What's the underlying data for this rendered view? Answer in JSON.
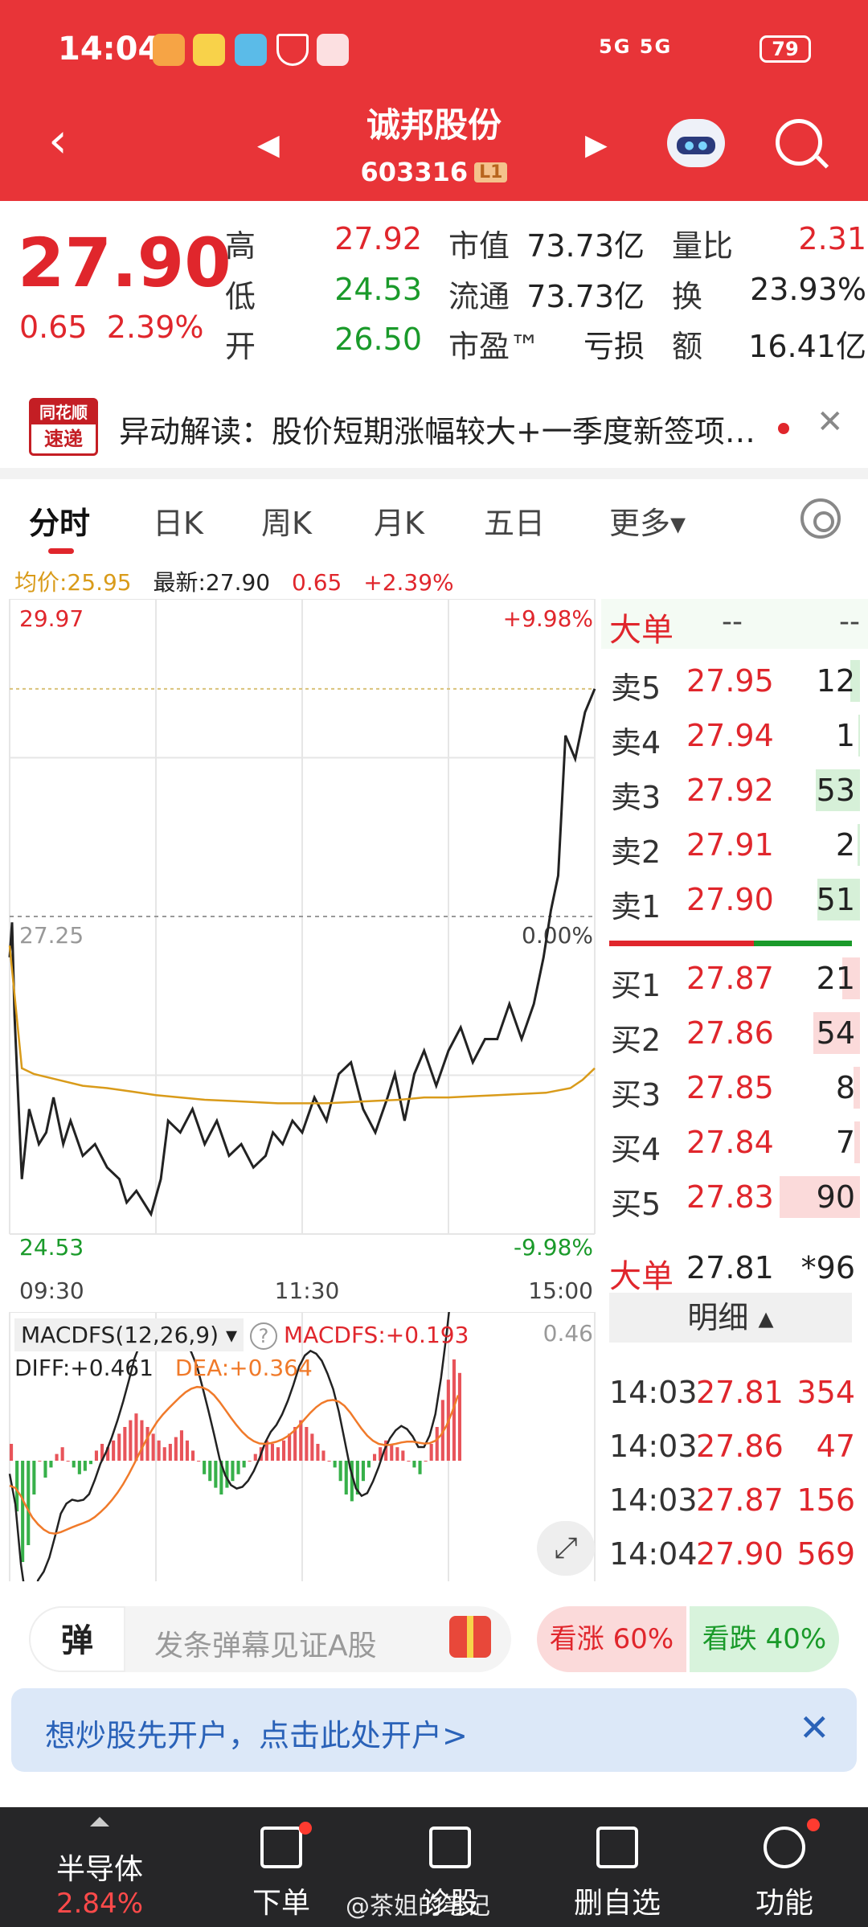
{
  "status_bar": {
    "time": "14:04",
    "signal": "5G 5G",
    "battery": "79"
  },
  "header": {
    "stock_name": "诚邦股份",
    "stock_code": "603316",
    "level": "L1"
  },
  "quote": {
    "price": "27.90",
    "change": "0.65",
    "change_pct": "2.39%",
    "high_label": "高",
    "high": "27.92",
    "low_label": "低",
    "low": "24.53",
    "open_label": "开",
    "open": "26.50",
    "mktcap_label": "市值",
    "mktcap": "73.73亿",
    "float_label": "流通",
    "float": "73.73亿",
    "pe_label": "市盈™",
    "pe": "亏损",
    "volratio_label": "量比",
    "volratio": "2.31",
    "turnover_label": "换",
    "turnover": "23.93%",
    "amount_label": "额",
    "amount": "16.41亿"
  },
  "news": {
    "logo_top": "同花顺",
    "logo_bottom": "速递",
    "text": "异动解读：股价短期涨幅较大+一季度新签项…"
  },
  "tabs": [
    "分时",
    "日K",
    "周K",
    "月K",
    "五日",
    "更多▾"
  ],
  "legend": {
    "avg": "均价:25.95",
    "latest": "最新:27.90",
    "change": "0.65",
    "change_pct": "+2.39%"
  },
  "chart_axis": {
    "top_price": "29.97",
    "mid_price": "27.25",
    "bottom_price": "24.53",
    "top_pct": "+9.98%",
    "mid_pct": "0.00%",
    "bottom_pct": "-9.98%",
    "time_start": "09:30",
    "time_mid": "11:30",
    "time_end": "15:00"
  },
  "chart_data": {
    "type": "line",
    "ylim": [
      24.53,
      29.97
    ],
    "reference": 27.25,
    "series": [
      {
        "name": "最新",
        "x": [
          0,
          1,
          2,
          5,
          8,
          12,
          15,
          18,
          22,
          25,
          30,
          35,
          40,
          45,
          48,
          52,
          58,
          62,
          65,
          70,
          75,
          80,
          85,
          90,
          95,
          100,
          105,
          108,
          112,
          116,
          120,
          125,
          130,
          135,
          140,
          145,
          150,
          155,
          158,
          162,
          166,
          170,
          175,
          180,
          185,
          190,
          195,
          200,
          205,
          210,
          215,
          219,
          222,
          225,
          228,
          232,
          236,
          240
        ],
        "values": [
          26.9,
          27.2,
          26.4,
          25.0,
          25.6,
          25.3,
          25.4,
          25.7,
          25.3,
          25.5,
          25.2,
          25.3,
          25.1,
          25.0,
          24.8,
          24.9,
          24.7,
          25.0,
          25.5,
          25.4,
          25.6,
          25.3,
          25.5,
          25.2,
          25.3,
          25.1,
          25.2,
          25.4,
          25.3,
          25.5,
          25.4,
          25.7,
          25.5,
          25.9,
          26.0,
          25.6,
          25.4,
          25.7,
          25.9,
          25.5,
          25.9,
          26.1,
          25.8,
          26.1,
          26.3,
          26.0,
          26.2,
          26.2,
          26.5,
          26.2,
          26.5,
          26.9,
          27.3,
          27.6,
          28.8,
          28.6,
          29.0,
          29.2
        ]
      },
      {
        "name": "均价",
        "x": [
          0,
          5,
          10,
          20,
          30,
          40,
          50,
          60,
          70,
          80,
          90,
          100,
          110,
          120,
          130,
          140,
          150,
          160,
          170,
          180,
          190,
          200,
          210,
          220,
          230,
          235,
          240
        ],
        "values": [
          27.0,
          25.95,
          25.9,
          25.85,
          25.8,
          25.78,
          25.75,
          25.72,
          25.7,
          25.68,
          25.67,
          25.66,
          25.65,
          25.65,
          25.65,
          25.66,
          25.67,
          25.68,
          25.7,
          25.7,
          25.71,
          25.72,
          25.73,
          25.74,
          25.78,
          25.85,
          25.95
        ]
      }
    ]
  },
  "macd": {
    "name": "MACDFS(12,26,9)",
    "value_label": "MACDFS:+0.193",
    "diff": "DIFF:+0.461",
    "dea": "DEA:+0.364",
    "scale": "0.46",
    "bars": [
      0.05,
      -0.15,
      -0.3,
      -0.25,
      -0.1,
      0.0,
      -0.05,
      -0.02,
      0.02,
      0.04,
      0.0,
      -0.02,
      -0.04,
      -0.03,
      -0.01,
      0.03,
      0.05,
      0.04,
      0.06,
      0.08,
      0.1,
      0.12,
      0.14,
      0.12,
      0.1,
      0.08,
      0.06,
      0.04,
      0.05,
      0.07,
      0.09,
      0.06,
      0.03,
      0.0,
      -0.04,
      -0.06,
      -0.08,
      -0.1,
      -0.08,
      -0.06,
      -0.04,
      -0.02,
      0.0,
      0.02,
      0.04,
      0.06,
      0.05,
      0.04,
      0.06,
      0.08,
      0.1,
      0.12,
      0.1,
      0.08,
      0.05,
      0.03,
      0.0,
      -0.02,
      -0.06,
      -0.1,
      -0.12,
      -0.1,
      -0.06,
      -0.02,
      0.02,
      0.04,
      0.06,
      0.05,
      0.04,
      0.03,
      0.0,
      -0.02,
      -0.04,
      0.0,
      0.05,
      0.1,
      0.18,
      0.24,
      0.3,
      0.26
    ]
  },
  "order_book": {
    "big_order_label": "大单",
    "big_order_v1": "--",
    "big_order_v2": "--",
    "asks": [
      {
        "label": "卖5",
        "price": "27.95",
        "vol": "12",
        "bar": 0.12
      },
      {
        "label": "卖4",
        "price": "27.94",
        "vol": "1",
        "bar": 0.02
      },
      {
        "label": "卖3",
        "price": "27.92",
        "vol": "53",
        "bar": 0.55
      },
      {
        "label": "卖2",
        "price": "27.91",
        "vol": "2",
        "bar": 0.03
      },
      {
        "label": "卖1",
        "price": "27.90",
        "vol": "51",
        "bar": 0.53
      }
    ],
    "bids": [
      {
        "label": "买1",
        "price": "27.87",
        "vol": "21",
        "bar": 0.22
      },
      {
        "label": "买2",
        "price": "27.86",
        "vol": "54",
        "bar": 0.58
      },
      {
        "label": "买3",
        "price": "27.85",
        "vol": "8",
        "bar": 0.08
      },
      {
        "label": "买4",
        "price": "27.84",
        "vol": "7",
        "bar": 0.07
      },
      {
        "label": "买5",
        "price": "27.83",
        "vol": "90",
        "bar": 1.0
      }
    ],
    "big_trade_label": "大单",
    "big_trade_price": "27.81",
    "big_trade_vol": "*96",
    "detail_label": "明细 ▴",
    "trades": [
      {
        "time": "14:03",
        "price": "27.81",
        "vol": "354"
      },
      {
        "time": "14:03",
        "price": "27.86",
        "vol": "47"
      },
      {
        "time": "14:03",
        "price": "27.87",
        "vol": "156"
      },
      {
        "time": "14:04",
        "price": "27.90",
        "vol": "569"
      }
    ]
  },
  "danmaku": {
    "badge": "弹",
    "placeholder": "发条弹幕见证A股",
    "bull": "看涨 60%",
    "bear": "看跌 40%"
  },
  "promo": {
    "text": "想炒股先开户，点击此处开户>",
    "close": "✕"
  },
  "bottom_nav": {
    "sector_label": "半导体",
    "sector_value": "2.84%",
    "items": [
      "下单",
      "诊股",
      "删自选",
      "功能"
    ]
  },
  "watermark": "@茶姐的笔记"
}
